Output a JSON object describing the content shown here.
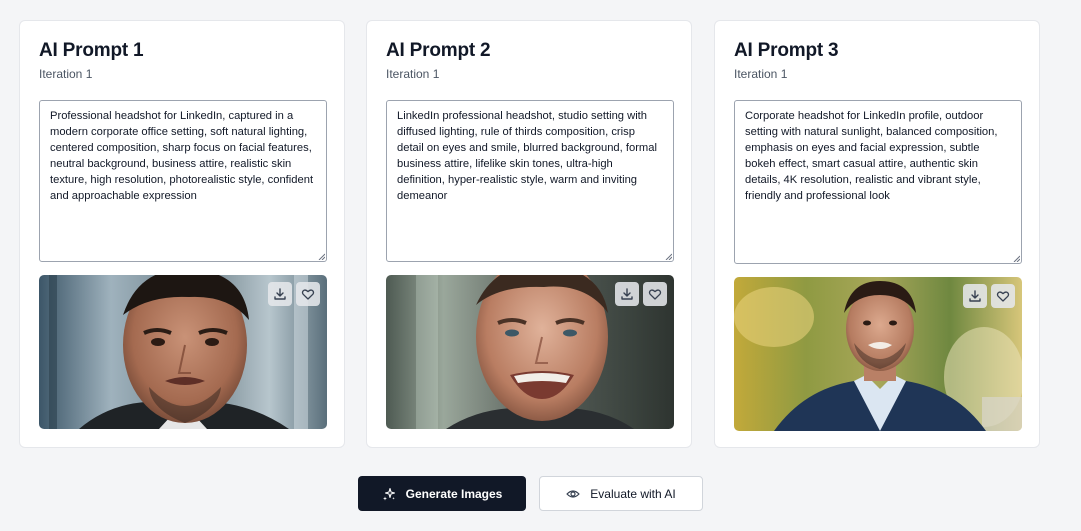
{
  "cards": [
    {
      "title": "AI Prompt 1",
      "subtitle": "Iteration 1",
      "prompt": "Professional headshot for LinkedIn, captured in a modern corporate office setting, soft natural lighting, centered composition, sharp focus on facial features, neutral background, business attire, realistic skin texture, high resolution, photorealistic style, confident and approachable expression",
      "image": {
        "description": "close-up portrait photo",
        "download_icon": "download-icon",
        "favorite_icon": "heart-icon"
      }
    },
    {
      "title": "AI Prompt 2",
      "subtitle": "Iteration 1",
      "prompt": "LinkedIn professional headshot, studio setting with diffused lighting, rule of thirds composition, crisp detail on eyes and smile, blurred background, formal business attire, lifelike skin tones, ultra-high definition, hyper-realistic style, warm and inviting demeanor",
      "image": {
        "description": "smiling portrait photo",
        "download_icon": "download-icon",
        "favorite_icon": "heart-icon"
      }
    },
    {
      "title": "AI Prompt 3",
      "subtitle": "Iteration 1",
      "prompt": "Corporate headshot for LinkedIn profile, outdoor setting with natural sunlight, balanced composition, emphasis on eyes and facial expression, subtle bokeh effect, smart casual attire, authentic skin details, 4K resolution, realistic and vibrant style, friendly and professional look",
      "image": {
        "description": "outdoor portrait photo in blazer",
        "download_icon": "download-icon",
        "favorite_icon": "heart-icon"
      }
    }
  ],
  "actions": {
    "generate_label": "Generate Images",
    "generate_icon": "sparkles-icon",
    "evaluate_label": "Evaluate with AI",
    "evaluate_icon": "eye-icon"
  },
  "colors": {
    "page_background": "#f4f5f7",
    "card_background": "#ffffff",
    "primary_button": "#111827",
    "text": "#111827",
    "muted_text": "#4b5563"
  }
}
